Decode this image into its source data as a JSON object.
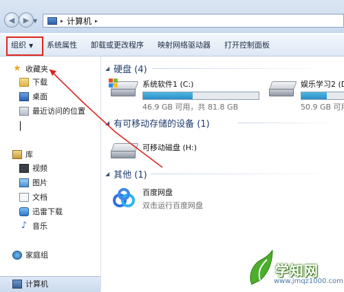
{
  "address_bar": {
    "back_glyph": "◀",
    "forward_glyph": "▶",
    "path_sep1": "▸",
    "location": "计算机",
    "path_sep2": "▸"
  },
  "toolbar": {
    "organize": "组织",
    "organize_arrow": "▼",
    "system_properties": "系统属性",
    "uninstall": "卸载或更改程序",
    "map_drive": "映射网络驱动器",
    "control_panel": "打开控制面板"
  },
  "sidebar": {
    "favorites": "收藏夹",
    "downloads": "下载",
    "desktop": "桌面",
    "recent": "最近访问的位置",
    "libraries": "库",
    "videos": "视频",
    "pictures": "图片",
    "documents": "文档",
    "xunlei": "迅雷下载",
    "music": "音乐",
    "homegroup": "家庭组",
    "computer": "计算机"
  },
  "main": {
    "hdd_group": "硬盘 (4)",
    "drives": [
      {
        "name": "系统软件1 (C:)",
        "size": "46.9 GB 可用，共 81.8 GB",
        "used_fraction": 0.43
      },
      {
        "name": "娱乐学习2 (D",
        "size": "50.9 GB 可用",
        "used_fraction": 0.55
      }
    ],
    "removable_group": "有可移动存储的设备 (1)",
    "removable_name": "可移动磁盘 (H:)",
    "other_group": "其他 (1)",
    "baidu_name": "百度网盘",
    "baidu_desc": "双击运行百度网盘"
  },
  "watermark": {
    "brand": "学知网",
    "url": "www.jmqz1000.com"
  },
  "colors": {
    "annotation_red": "#e0241b",
    "bar_fill": "#2b8fc8",
    "group_title": "#1e3b6e"
  }
}
